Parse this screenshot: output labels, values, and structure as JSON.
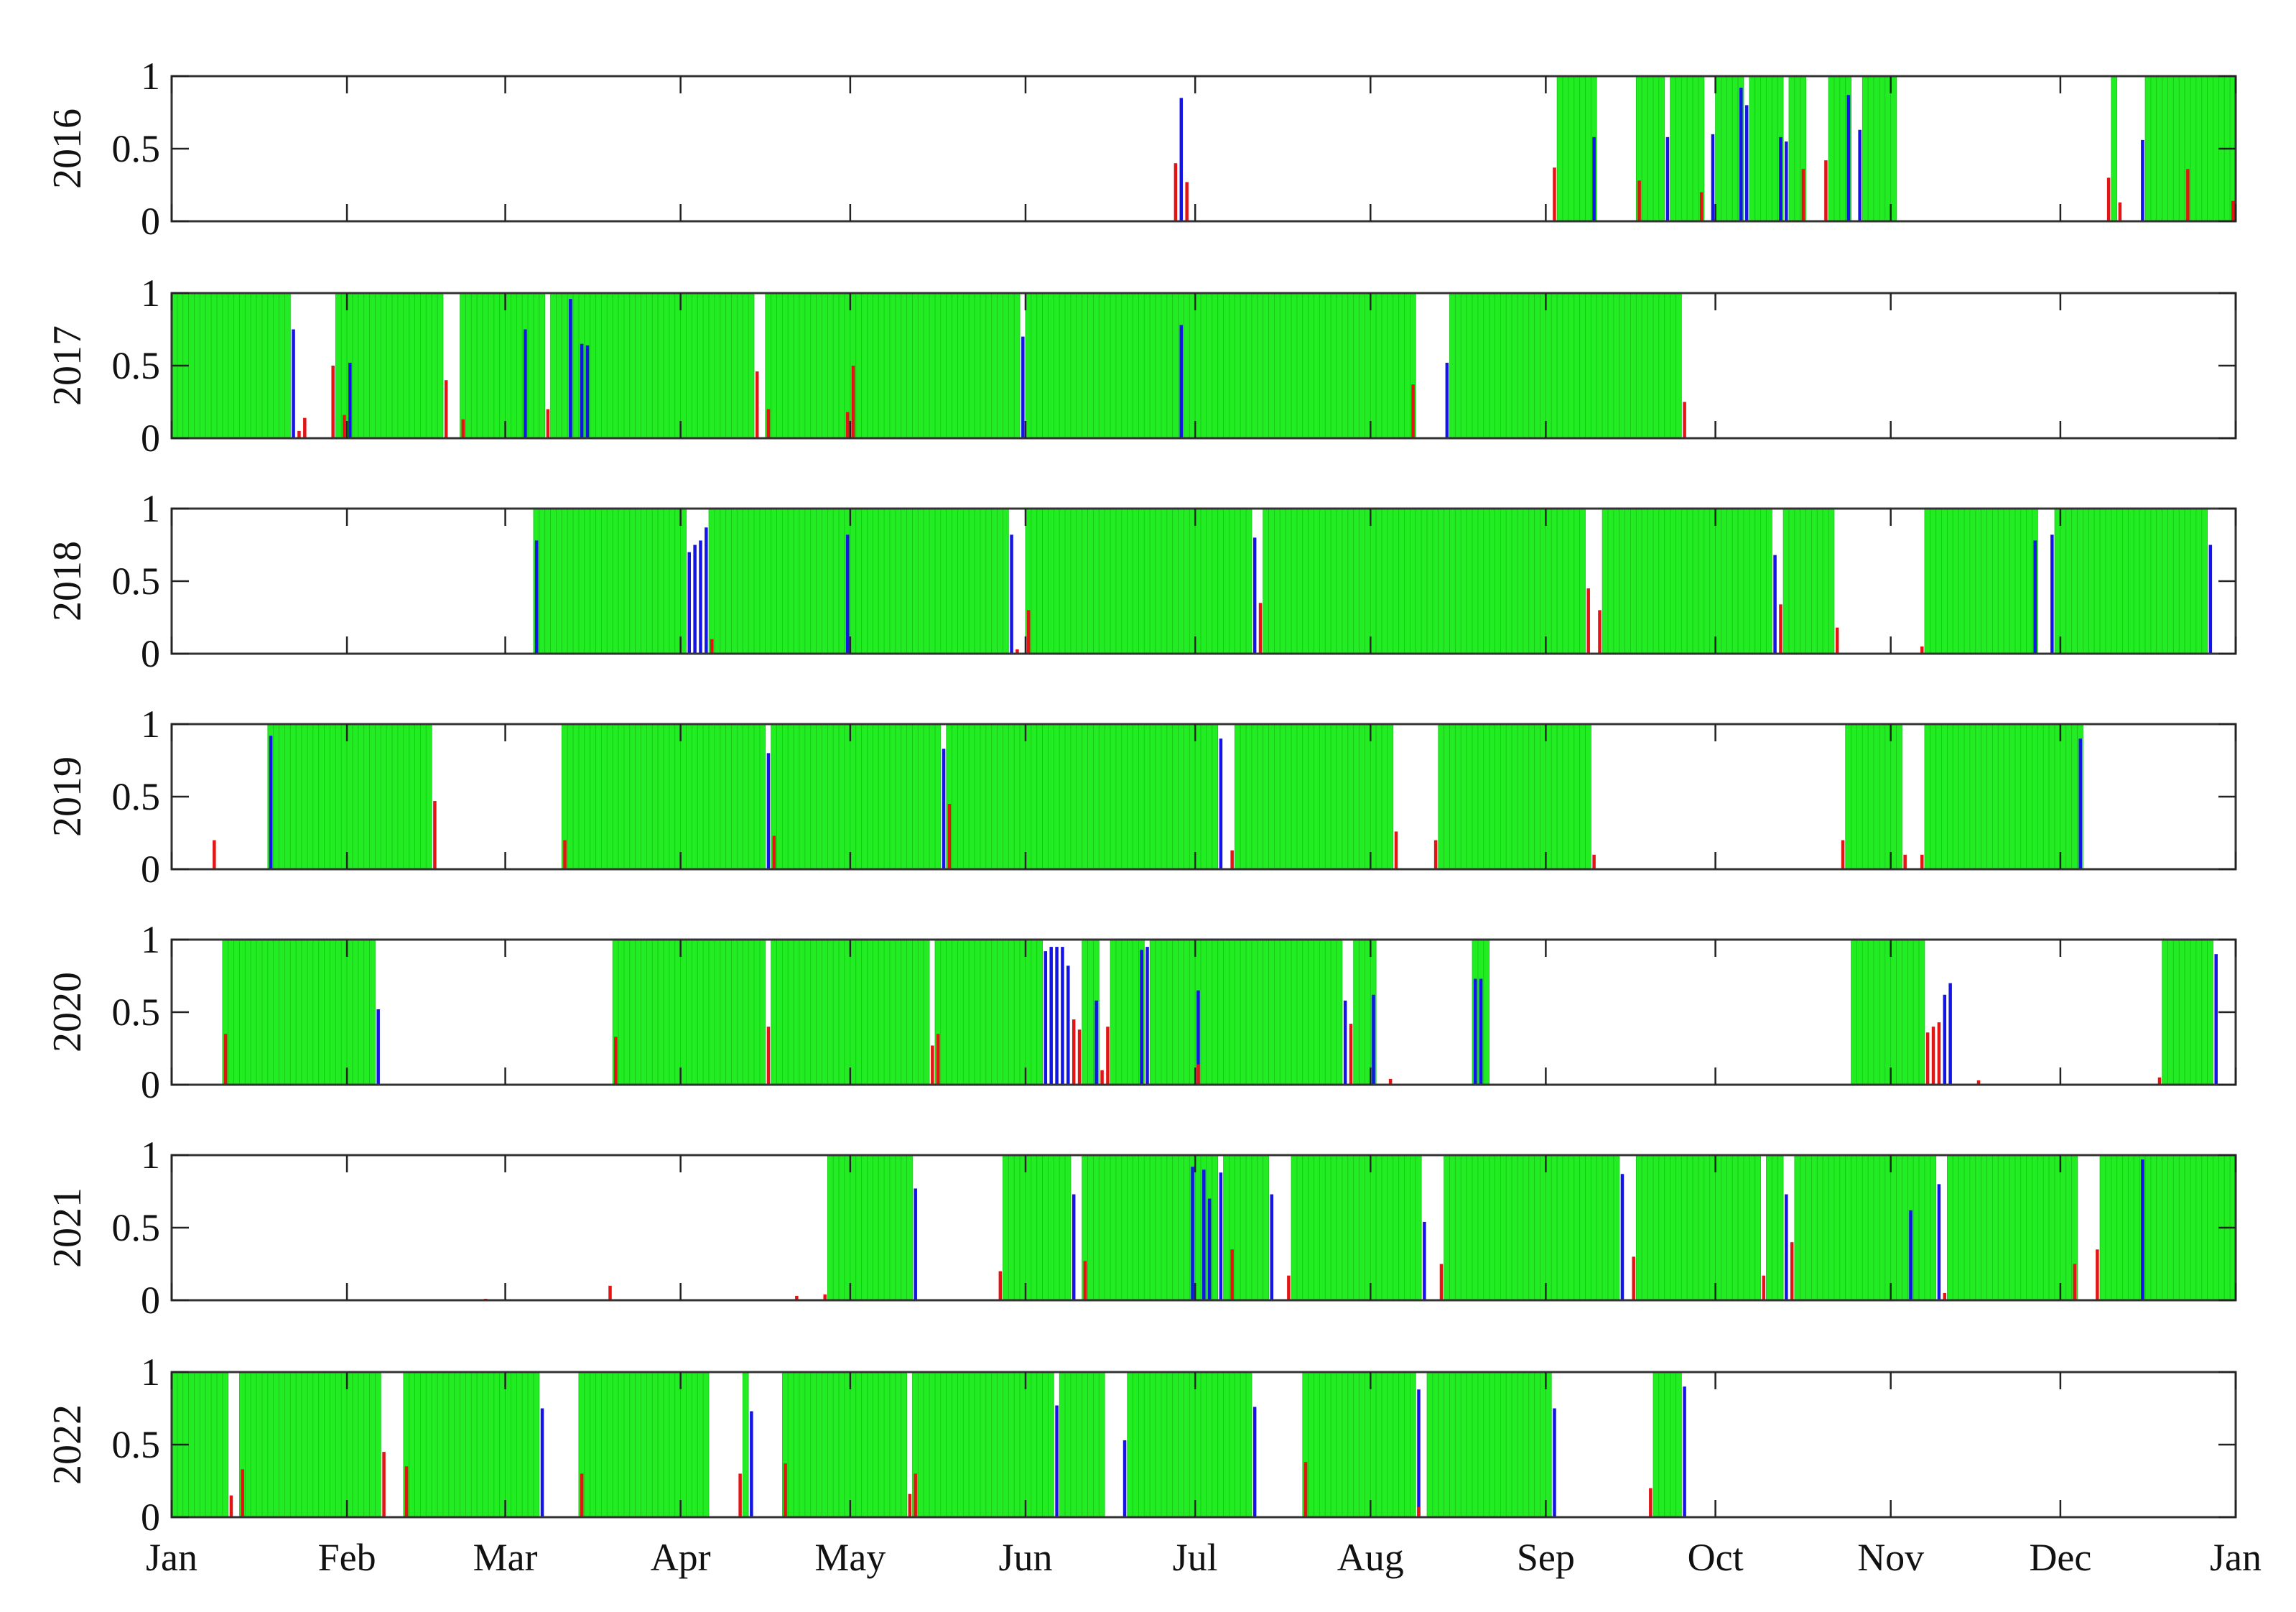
{
  "colors": {
    "full": "#22ec22",
    "full_stripe": "#19c419",
    "blue": "#1414e6",
    "red": "#e41414",
    "axis": "#333333"
  },
  "months": [
    "Jan",
    "Feb",
    "Mar",
    "Apr",
    "May",
    "Jun",
    "Jul",
    "Aug",
    "Sep",
    "Oct",
    "Nov",
    "Dec",
    "Jan"
  ],
  "month_start_days": [
    0,
    31,
    59,
    90,
    120,
    151,
    181,
    212,
    243,
    273,
    304,
    334,
    365
  ],
  "yticks": [
    "1",
    "0.5",
    "0"
  ],
  "chart_data": [
    {
      "type": "bar",
      "year": "2016",
      "ylim": [
        0,
        1
      ],
      "xlim_days": [
        0,
        365
      ],
      "green_ranges": [
        [
          245,
          251
        ],
        [
          259,
          263
        ],
        [
          265,
          270
        ],
        [
          273,
          277
        ],
        [
          279,
          284
        ],
        [
          286,
          288
        ],
        [
          293,
          296
        ],
        [
          299,
          304
        ],
        [
          343,
          343
        ],
        [
          349,
          356
        ],
        [
          357,
          364
        ]
      ],
      "blue": [
        [
          178,
          0.85
        ],
        [
          251,
          0.58
        ],
        [
          264,
          0.58
        ],
        [
          272,
          0.6
        ],
        [
          277,
          0.92
        ],
        [
          278,
          0.8
        ],
        [
          284,
          0.58
        ],
        [
          285,
          0.55
        ],
        [
          296,
          0.87
        ],
        [
          298,
          0.63
        ],
        [
          348,
          0.56
        ]
      ],
      "red": [
        [
          177,
          0.4
        ],
        [
          179,
          0.27
        ],
        [
          244,
          0.37
        ],
        [
          259,
          0.28
        ],
        [
          270,
          0.2
        ],
        [
          288,
          0.36
        ],
        [
          292,
          0.42
        ],
        [
          342,
          0.3
        ],
        [
          344,
          0.13
        ],
        [
          356,
          0.36
        ],
        [
          364,
          0.14
        ]
      ]
    },
    {
      "type": "bar",
      "year": "2017",
      "ylim": [
        0,
        1
      ],
      "xlim_days": [
        0,
        365
      ],
      "green_ranges": [
        [
          0,
          20
        ],
        [
          29,
          30
        ],
        [
          31,
          47
        ],
        [
          51,
          62
        ],
        [
          63,
          65
        ],
        [
          67,
          70
        ],
        [
          71,
          102
        ],
        [
          105,
          119
        ],
        [
          120,
          149
        ],
        [
          151,
          177
        ],
        [
          178,
          219
        ],
        [
          226,
          266
        ]
      ],
      "blue": [
        [
          21,
          0.75
        ],
        [
          31,
          0.52
        ],
        [
          62,
          0.75
        ],
        [
          70,
          0.96
        ],
        [
          72,
          0.65
        ],
        [
          73,
          0.64
        ],
        [
          150,
          0.7
        ],
        [
          178,
          0.78
        ],
        [
          225,
          0.52
        ]
      ],
      "red": [
        [
          22,
          0.05
        ],
        [
          23,
          0.14
        ],
        [
          28,
          0.5
        ],
        [
          30,
          0.16
        ],
        [
          48,
          0.4
        ],
        [
          51,
          0.13
        ],
        [
          66,
          0.2
        ],
        [
          103,
          0.46
        ],
        [
          105,
          0.2
        ],
        [
          119,
          0.18
        ],
        [
          120,
          0.5
        ],
        [
          219,
          0.37
        ],
        [
          267,
          0.25
        ]
      ]
    },
    {
      "type": "bar",
      "year": "2018",
      "ylim": [
        0,
        1
      ],
      "xlim_days": [
        0,
        365
      ],
      "green_ranges": [
        [
          64,
          90
        ],
        [
          95,
          119
        ],
        [
          120,
          147
        ],
        [
          151,
          190
        ],
        [
          193,
          249
        ],
        [
          253,
          282
        ],
        [
          285,
          293
        ],
        [
          310,
          329
        ],
        [
          333,
          359
        ]
      ],
      "blue": [
        [
          64,
          0.78
        ],
        [
          91,
          0.7
        ],
        [
          92,
          0.75
        ],
        [
          93,
          0.78
        ],
        [
          94,
          0.87
        ],
        [
          119,
          0.82
        ],
        [
          148,
          0.82
        ],
        [
          191,
          0.8
        ],
        [
          283,
          0.68
        ],
        [
          329,
          0.78
        ],
        [
          332,
          0.82
        ],
        [
          360,
          0.75
        ]
      ],
      "red": [
        [
          95,
          0.1
        ],
        [
          149,
          0.03
        ],
        [
          151,
          0.3
        ],
        [
          192,
          0.35
        ],
        [
          250,
          0.45
        ],
        [
          252,
          0.3
        ],
        [
          284,
          0.34
        ],
        [
          294,
          0.18
        ],
        [
          309,
          0.05
        ]
      ]
    },
    {
      "type": "bar",
      "year": "2019",
      "ylim": [
        0,
        1
      ],
      "xlim_days": [
        0,
        365
      ],
      "green_ranges": [
        [
          17,
          45
        ],
        [
          69,
          104
        ],
        [
          106,
          135
        ],
        [
          137,
          184
        ],
        [
          188,
          215
        ],
        [
          224,
          250
        ],
        [
          296,
          305
        ],
        [
          310,
          337
        ]
      ],
      "blue": [
        [
          17,
          0.92
        ],
        [
          105,
          0.8
        ],
        [
          136,
          0.83
        ],
        [
          185,
          0.9
        ],
        [
          337,
          0.9
        ]
      ],
      "red": [
        [
          7,
          0.2
        ],
        [
          46,
          0.47
        ],
        [
          69,
          0.2
        ],
        [
          106,
          0.23
        ],
        [
          137,
          0.45
        ],
        [
          187,
          0.13
        ],
        [
          216,
          0.26
        ],
        [
          223,
          0.2
        ],
        [
          251,
          0.1
        ],
        [
          295,
          0.2
        ],
        [
          306,
          0.1
        ],
        [
          309,
          0.1
        ]
      ]
    },
    {
      "type": "bar",
      "year": "2020",
      "ylim": [
        0,
        1
      ],
      "xlim_days": [
        0,
        365
      ],
      "green_ranges": [
        [
          9,
          35
        ],
        [
          78,
          104
        ],
        [
          106,
          133
        ],
        [
          135,
          153
        ],
        [
          161,
          163
        ],
        [
          166,
          171
        ],
        [
          173,
          180
        ],
        [
          181,
          206
        ],
        [
          209,
          212
        ],
        [
          230,
          232
        ],
        [
          297,
          309
        ],
        [
          352,
          360
        ]
      ],
      "blue": [
        [
          36,
          0.52
        ],
        [
          154,
          0.92
        ],
        [
          155,
          0.95
        ],
        [
          156,
          0.95
        ],
        [
          157,
          0.95
        ],
        [
          158,
          0.82
        ],
        [
          163,
          0.58
        ],
        [
          171,
          0.93
        ],
        [
          172,
          0.95
        ],
        [
          181,
          0.65
        ],
        [
          207,
          0.58
        ],
        [
          212,
          0.62
        ],
        [
          230,
          0.73
        ],
        [
          231,
          0.73
        ],
        [
          313,
          0.62
        ],
        [
          314,
          0.7
        ],
        [
          361,
          0.9
        ]
      ],
      "red": [
        [
          9,
          0.35
        ],
        [
          78,
          0.33
        ],
        [
          105,
          0.4
        ],
        [
          134,
          0.27
        ],
        [
          135,
          0.35
        ],
        [
          159,
          0.45
        ],
        [
          160,
          0.38
        ],
        [
          164,
          0.1
        ],
        [
          165,
          0.4
        ],
        [
          181,
          0.14
        ],
        [
          208,
          0.42
        ],
        [
          215,
          0.04
        ],
        [
          310,
          0.36
        ],
        [
          311,
          0.4
        ],
        [
          312,
          0.43
        ],
        [
          319,
          0.03
        ],
        [
          351,
          0.05
        ]
      ]
    },
    {
      "type": "bar",
      "year": "2021",
      "ylim": [
        0,
        1
      ],
      "xlim_days": [
        0,
        365
      ],
      "green_ranges": [
        [
          116,
          130
        ],
        [
          147,
          158
        ],
        [
          161,
          180
        ],
        [
          181,
          184
        ],
        [
          186,
          193
        ],
        [
          198,
          220
        ],
        [
          225,
          255
        ],
        [
          259,
          280
        ],
        [
          282,
          284
        ],
        [
          287,
          307
        ],
        [
          308,
          311
        ],
        [
          314,
          336
        ],
        [
          341,
          364
        ]
      ],
      "blue": [
        [
          131,
          0.77
        ],
        [
          159,
          0.73
        ],
        [
          180,
          0.92
        ],
        [
          182,
          0.9
        ],
        [
          183,
          0.7
        ],
        [
          185,
          0.88
        ],
        [
          194,
          0.73
        ],
        [
          221,
          0.54
        ],
        [
          256,
          0.87
        ],
        [
          285,
          0.73
        ],
        [
          307,
          0.62
        ],
        [
          312,
          0.8
        ],
        [
          348,
          0.97
        ]
      ],
      "red": [
        [
          55,
          0.01
        ],
        [
          77,
          0.1
        ],
        [
          110,
          0.03
        ],
        [
          115,
          0.04
        ],
        [
          146,
          0.2
        ],
        [
          161,
          0.27
        ],
        [
          187,
          0.35
        ],
        [
          197,
          0.17
        ],
        [
          224,
          0.25
        ],
        [
          258,
          0.3
        ],
        [
          281,
          0.17
        ],
        [
          286,
          0.4
        ],
        [
          313,
          0.05
        ],
        [
          336,
          0.25
        ],
        [
          340,
          0.35
        ]
      ]
    },
    {
      "type": "bar",
      "year": "2022",
      "ylim": [
        0,
        1
      ],
      "xlim_days": [
        0,
        365
      ],
      "green_ranges": [
        [
          0,
          9
        ],
        [
          12,
          36
        ],
        [
          41,
          64
        ],
        [
          72,
          94
        ],
        [
          101,
          101
        ],
        [
          108,
          129
        ],
        [
          131,
          155
        ],
        [
          157,
          164
        ],
        [
          169,
          190
        ],
        [
          200,
          219
        ],
        [
          222,
          243
        ],
        [
          262,
          266
        ]
      ],
      "blue": [
        [
          65,
          0.75
        ],
        [
          102,
          0.73
        ],
        [
          156,
          0.77
        ],
        [
          168,
          0.53
        ],
        [
          191,
          0.76
        ],
        [
          220,
          0.88
        ],
        [
          244,
          0.75
        ],
        [
          267,
          0.9
        ]
      ],
      "red": [
        [
          10,
          0.15
        ],
        [
          12,
          0.33
        ],
        [
          37,
          0.45
        ],
        [
          41,
          0.35
        ],
        [
          72,
          0.3
        ],
        [
          100,
          0.3
        ],
        [
          108,
          0.37
        ],
        [
          130,
          0.16
        ],
        [
          131,
          0.3
        ],
        [
          200,
          0.38
        ],
        [
          220,
          0.07
        ],
        [
          261,
          0.2
        ]
      ]
    }
  ]
}
